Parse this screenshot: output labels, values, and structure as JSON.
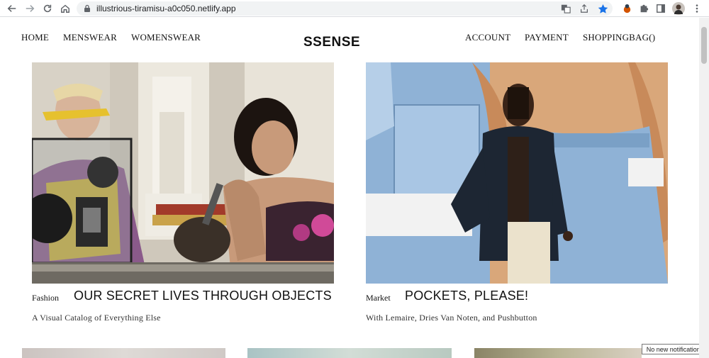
{
  "browser": {
    "url": "illustrious-tiramisu-a0c050.netlify.app",
    "icons": [
      "back-icon",
      "forward-icon",
      "reload-icon",
      "home-icon",
      "lock-icon",
      "translate-icon",
      "share-icon",
      "bookmark-star-icon",
      "extension-icon",
      "puzzle-icon",
      "sidepanel-icon",
      "avatar",
      "kebab-menu-icon"
    ],
    "accent": "#1a73e8"
  },
  "site": {
    "logo": "SSENSE",
    "nav_left": [
      "HOME",
      "MENSWEAR",
      "WOMENSWEAR"
    ],
    "nav_right": [
      "ACCOUNT",
      "PAYMENT",
      "SHOPPINGBAG()"
    ]
  },
  "features": [
    {
      "category": "Fashion",
      "title": "OUR SECRET LIVES THROUGH OBJECTS",
      "subtitle": "A Visual Catalog of Everything Else"
    },
    {
      "category": "Market",
      "title": "POCKETS, PLEASE!",
      "subtitle": "With Lemaire, Dries Van Noten, and Pushbutton"
    }
  ],
  "notification": "No new notifications"
}
